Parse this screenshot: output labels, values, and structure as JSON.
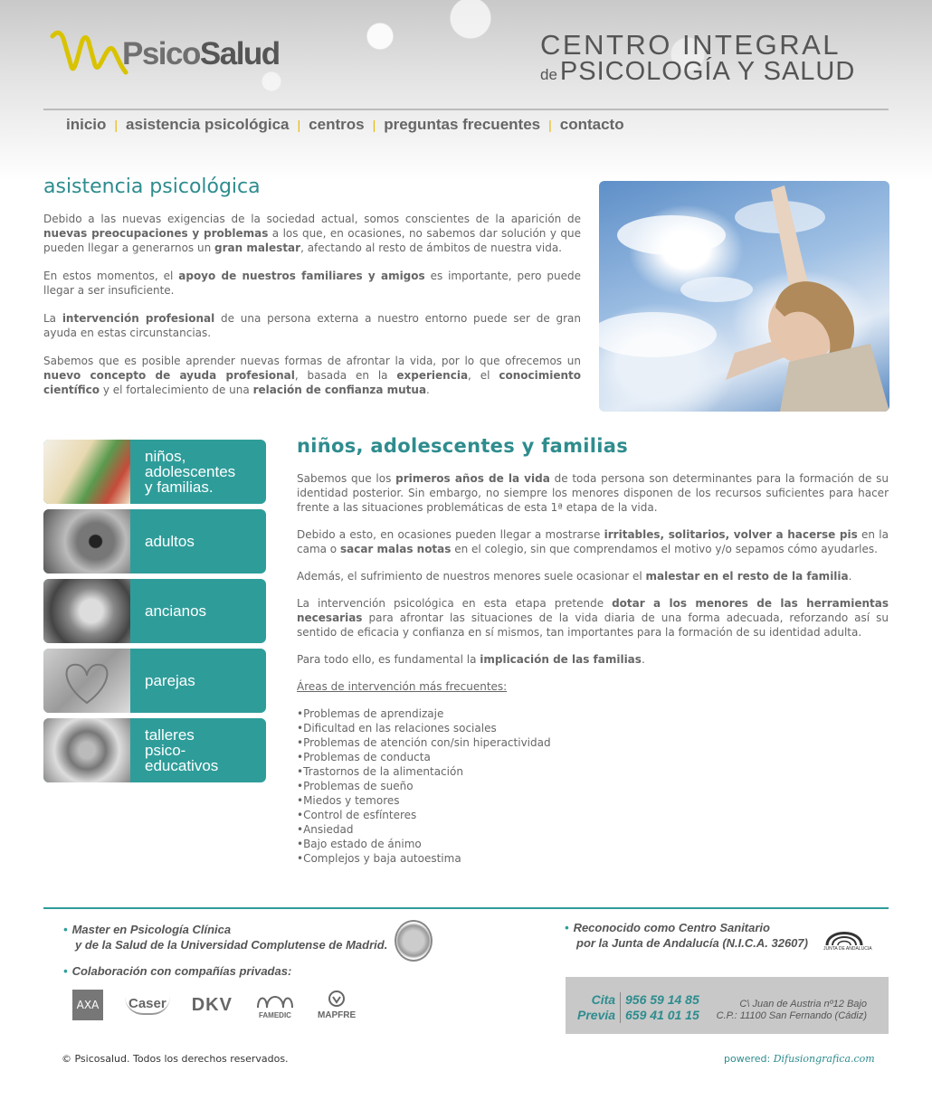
{
  "header": {
    "logo_left": "Psico",
    "logo_right": "Salud",
    "tagline_line1": "CENTRO INTEGRAL",
    "tagline_de": "de",
    "tagline_line2": "PSICOLOGÍA Y SALUD"
  },
  "nav": {
    "items": [
      "inicio",
      "asistencia psicológica",
      "centros",
      "preguntas frecuentes",
      "contacto"
    ],
    "separator": "|"
  },
  "intro": {
    "title": "asistencia psicológica",
    "p1": [
      "Debido a las nuevas exigencias de la sociedad actual, somos conscientes de la aparición de ",
      "nuevas preocupaciones y problemas",
      " a los que, en ocasiones, no sabemos dar solución y que pueden llegar a generarnos un ",
      "gran malestar",
      ", afectando al resto de ámbitos de nuestra vida."
    ],
    "p2": [
      "En estos momentos, el ",
      "apoyo de nuestros familiares y amigos",
      " es importante, pero puede llegar a ser insuficiente."
    ],
    "p3": [
      "La ",
      "intervención profesional",
      " de una persona externa a nuestro entorno puede ser de gran ayuda en estas circunstancias."
    ],
    "p4": [
      "Sabemos que es posible aprender nuevas formas de afrontar la vida, por lo que ofrecemos un ",
      "nuevo concepto de ayuda profesional",
      ", basada en la ",
      "experiencia",
      ", el ",
      "conocimiento científico",
      " y el fortalecimiento de una ",
      "relación de confianza mutua",
      "."
    ]
  },
  "menu": [
    "niños,\nadolescentes\ny familias.",
    "adultos",
    "ancianos",
    "parejas",
    "talleres\npsico-\neducativos"
  ],
  "section": {
    "title": "niños, adolescentes y familias",
    "p1": [
      "Sabemos que los ",
      "primeros años de la vida",
      " de toda persona son determinantes para la formación de su identidad posterior. Sin embargo, no siempre los menores disponen de los recursos suficientes para hacer frente a las situaciones problemáticas de esta 1ª etapa de la vida."
    ],
    "p2": [
      "Debido a esto, en ocasiones pueden llegar a mostrarse ",
      "irritables, solitarios, volver a hacerse pis",
      " en la cama o ",
      "sacar malas notas",
      " en el colegio, sin que comprendamos el motivo y/o sepamos cómo ayudarles."
    ],
    "p3": [
      "Además, el sufrimiento de nuestros menores suele ocasionar el ",
      "malestar en el resto de la familia",
      "."
    ],
    "p4": [
      "La intervención psicológica en esta etapa pretende ",
      "dotar a los menores de las herramientas necesarias",
      " para afrontar las situaciones de la vida diaria de una forma adecuada, reforzando así su sentido de eficacia y confianza en sí mismos, tan importantes para la formación de su identidad adulta."
    ],
    "p5": [
      "Para todo ello, es fundamental la ",
      "implicación de las familias",
      "."
    ],
    "areas_title": "Áreas de intervención más frecuentes:",
    "areas": [
      "Problemas de aprendizaje",
      "Dificultad en las relaciones sociales",
      "Problemas de atención con/sin hiperactividad",
      "Problemas de conducta",
      "Trastornos de la alimentación",
      "Problemas de sueño",
      "Miedos y temores",
      "Control de esfínteres",
      "Ansiedad",
      "Bajo estado de ánimo",
      "Complejos y baja autoestima"
    ]
  },
  "footer": {
    "master_l1": "Master en Psicología Clínica",
    "master_l2": "y de la Salud de la Universidad Complutense de Madrid.",
    "reconocido_l1": "Reconocido como Centro Sanitario",
    "reconocido_l2": "por la Junta de Andalucía (N.I.C.A. 32607)",
    "junta_label": "JUNTA DE ANDALUCIA",
    "collab": "Colaboración con compañías privadas:",
    "brands": [
      "AXA",
      "Caser",
      "DKV",
      "FAMEDIC",
      "MAPFRE"
    ],
    "cita": "Cita",
    "previa": "Previa",
    "phone1": "956 59 14 85",
    "phone2": "659 41 01 15",
    "addr1": "C\\ Juan de Austria nº12 Bajo",
    "addr2": "C.P.: 11100 San Fernando (Cádiz)",
    "copyright": "© Psicosalud. Todos los derechos reservados.",
    "powered": "powered:",
    "powered_by": "Difusiongrafica.com"
  },
  "colors": {
    "accent": "#2e9d9a",
    "title": "#2e8c8e",
    "nav_sep": "#e6b800",
    "text": "#666666"
  }
}
